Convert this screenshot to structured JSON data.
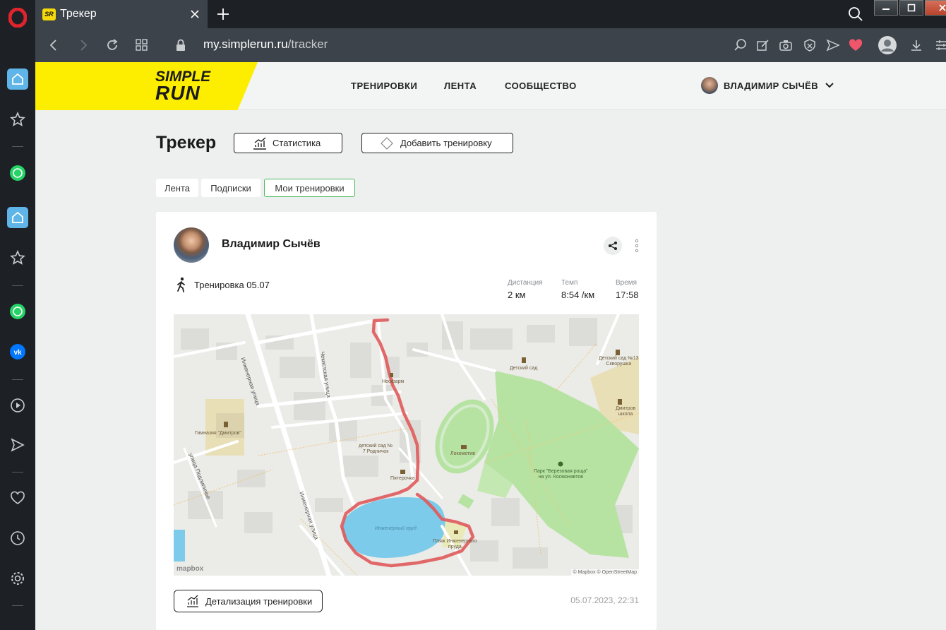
{
  "browser": {
    "tab_favicon_text": "SR",
    "tab_title": "Трекер",
    "url_domain": "my.simplerun.ru",
    "url_path": "/tracker"
  },
  "site": {
    "logo_line1": "SIMPLE",
    "logo_line2": "RUN",
    "nav": [
      "ТРЕНИРОВКИ",
      "ЛЕНТА",
      "СООБЩЕСТВО"
    ],
    "user_name": "ВЛАДИМИР СЫЧЁВ"
  },
  "page": {
    "title": "Трекер",
    "stats_button": "Статистика",
    "add_button": "Добавить тренировку",
    "filter_tabs": [
      "Лента",
      "Подписки",
      "Мои тренировки"
    ],
    "active_tab": "Мои тренировки"
  },
  "workout": {
    "author": "Владимир Сычёв",
    "name": "Тренировка 05.07",
    "distance_label": "Дистанция",
    "distance_value": "2 км",
    "pace_label": "Темп",
    "pace_value": "8:54 /км",
    "time_label": "Время",
    "time_value": "17:58",
    "detail_button": "Детализация тренировки",
    "datetime": "05.07.2023, 22:31"
  },
  "map": {
    "labels": {
      "gym": "Гимназия \"Дмитров\"",
      "kindergarten_rodnichok": "детский сад №\n7 Родничок",
      "pyaterochka": "Пятерочка",
      "neopharm": "Неофарм",
      "lokomotiv": "Локомотив",
      "kindergarten": "Детский сад",
      "kindergarten13": "Детский сад №13\nСкворушка",
      "school": "Дмитров\nшкола",
      "park": "Парк \"Березовая роща\"\nна ул. Космонавтов",
      "pond": "Инженерный пруд",
      "beach": "Пляж Инженерного\nпруда"
    },
    "streets": {
      "inzhenernaya1": "Инженерная улица",
      "inzhenernaya2": "Инженерная улица",
      "chekistskaya": "Чекистская улица",
      "podlipichye": "улица Подлипичье"
    },
    "mapbox_logo": "mapbox",
    "attribution": "© Mapbox © OpenStreetMap"
  },
  "colors": {
    "accent_yellow": "#fdee00",
    "active_green": "#4cba5a",
    "route_red": "#e05a5a"
  }
}
